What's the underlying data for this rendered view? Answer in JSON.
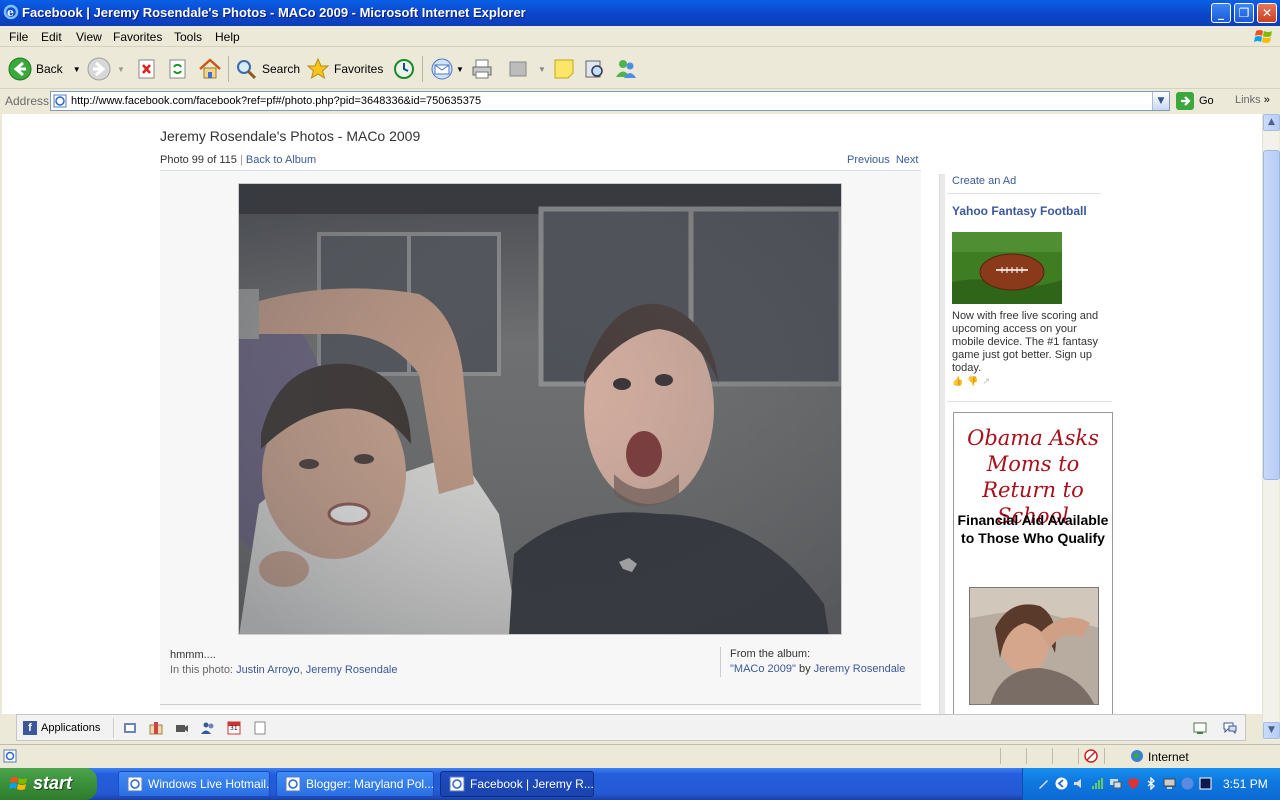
{
  "window": {
    "title": "Facebook | Jeremy Rosendale's Photos - MACo 2009 - Microsoft Internet Explorer"
  },
  "menu": [
    "File",
    "Edit",
    "View",
    "Favorites",
    "Tools",
    "Help"
  ],
  "toolbar": {
    "back_label": "Back",
    "search_label": "Search",
    "favorites_label": "Favorites"
  },
  "address": {
    "label": "Address",
    "url": "http://www.facebook.com/facebook?ref=pf#/photo.php?pid=3648336&id=750635375",
    "go_label": "Go",
    "links_label": "Links"
  },
  "page": {
    "title": "Jeremy Rosendale's Photos - MACo 2009",
    "photo_count": "Photo 99 of 115",
    "separator": "|",
    "back_to_album": "Back to Album",
    "previous": "Previous",
    "next": "Next",
    "caption": "hmmm....",
    "in_this_photo_label": "In this photo:",
    "tagged": [
      "Justin Arroyo",
      "Jeremy Rosendale"
    ],
    "tag_separator": ",",
    "from_album_label": "From the album:",
    "album_name": "\"MACo 2009\"",
    "by_label": "by",
    "album_owner": "Jeremy Rosendale"
  },
  "ads": {
    "create_ad": "Create an Ad",
    "ad_title": "Yahoo Fantasy Football",
    "ad_body": "Now with free live scoring and upcoming access on your mobile device. The #1 fantasy game just got better. Sign up today.",
    "banner_headline": "Obama Asks Moms to Return to School",
    "banner_sub": "Financial Aid Available to Those Who Qualify"
  },
  "fb_bar": {
    "applications_label": "Applications",
    "calendar_day": "31"
  },
  "statusbar": {
    "zone": "Internet"
  },
  "taskbar": {
    "start_label": "start",
    "tasks": [
      {
        "label": "Windows Live Hotmail..."
      },
      {
        "label": "Blogger: Maryland Pol..."
      },
      {
        "label": "Facebook | Jeremy R..."
      }
    ],
    "clock": "3:51 PM"
  },
  "colors": {
    "fb_link": "#3b5998",
    "xp_blue": "#0a44c8",
    "banner_red": "#a8101c"
  }
}
